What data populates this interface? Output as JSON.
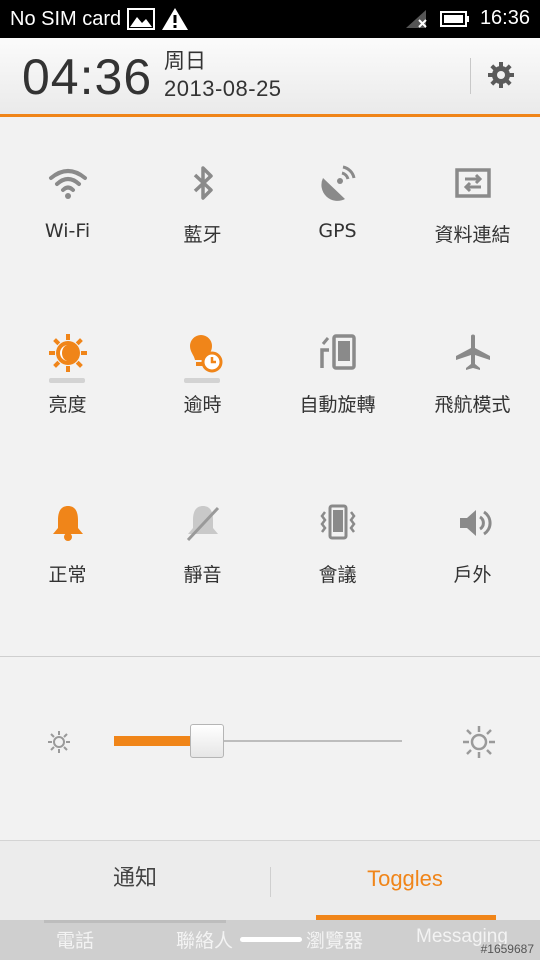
{
  "status_bar": {
    "carrier": "No SIM card",
    "time": "16:36",
    "icons": [
      "image-icon",
      "warning-icon",
      "signal-off-icon",
      "battery-icon"
    ]
  },
  "header": {
    "clock": "04:36",
    "weekday": "周日",
    "date": "2013-08-25",
    "settings_icon": "gear-icon"
  },
  "toggles": [
    {
      "label": "Wi-Fi",
      "icon": "wifi-icon",
      "active": false
    },
    {
      "label": "藍牙",
      "icon": "bluetooth-icon",
      "active": false
    },
    {
      "label": "GPS",
      "icon": "gps-icon",
      "active": false
    },
    {
      "label": "資料連結",
      "icon": "data-link-icon",
      "active": false
    },
    {
      "label": "亮度",
      "icon": "brightness-icon",
      "active": true
    },
    {
      "label": "逾時",
      "icon": "timeout-icon",
      "active": true
    },
    {
      "label": "自動旋轉",
      "icon": "auto-rotate-icon",
      "active": false
    },
    {
      "label": "飛航模式",
      "icon": "airplane-icon",
      "active": false
    },
    {
      "label": "正常",
      "icon": "bell-icon",
      "active": true
    },
    {
      "label": "靜音",
      "icon": "silent-icon",
      "active": false
    },
    {
      "label": "會議",
      "icon": "vibrate-icon",
      "active": false
    },
    {
      "label": "戶外",
      "icon": "speaker-icon",
      "active": false
    }
  ],
  "brightness": {
    "level": 0.32
  },
  "tabs": {
    "notifications": "通知",
    "toggles": "Toggles",
    "selected": "toggles"
  },
  "dock": {
    "items": [
      "電話",
      "聯絡人",
      "瀏覽器",
      "Messaging"
    ]
  },
  "watermark": "#1659687",
  "colors": {
    "accent": "#f08519",
    "icon_gray": "#8a8a8a",
    "text": "#333333"
  }
}
